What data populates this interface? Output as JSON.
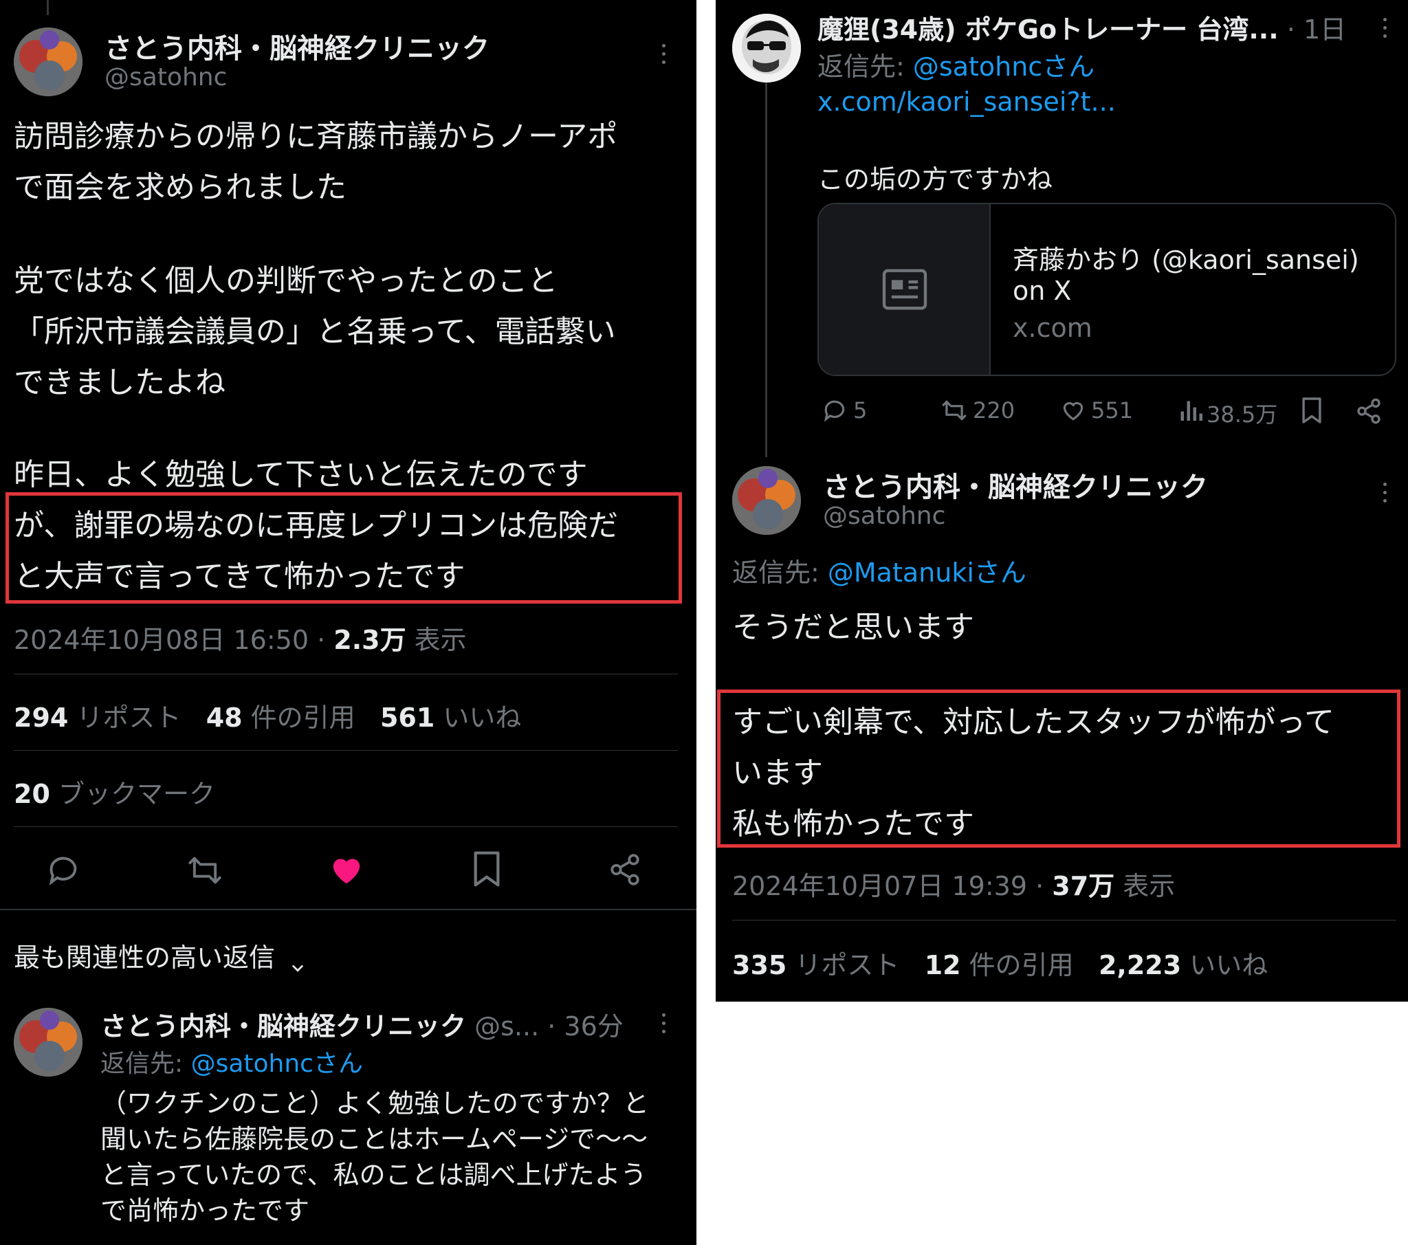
{
  "left": {
    "tweet": {
      "author_name": "さとう内科・脳神経クリニック",
      "author_handle": "@satohnc",
      "text_lines": [
        "訪問診療からの帰りに斉藤市議からノーアポ",
        "で面会を求められました",
        "党ではなく個人の判断でやったとのこと",
        "「所沢市議会議員の」と名乗って、電話繋い",
        "できましたよね",
        "昨日、よく勉強して下さいと伝えたのです",
        "が、謝罪の場なのに再度レプリコンは危険だ",
        "と大声で言ってきて怖かったです"
      ],
      "timestamp": "2024年10月08日 16:50 · ",
      "views_count": "2.3万",
      "views_label": " 表示",
      "stats": {
        "reposts_count": "294",
        "reposts_label": "リポスト",
        "quotes_count": "48",
        "quotes_label": "件の引用",
        "likes_count": "561",
        "likes_label": "いいね",
        "bookmarks_count": "20",
        "bookmarks_label": "ブックマーク"
      },
      "liked": true,
      "icons": [
        "reply-icon",
        "repost-icon",
        "heart-icon",
        "bookmark-icon",
        "share-icon"
      ]
    },
    "reply_sort_label": "最も関連性の高い返信",
    "reply": {
      "author_name": "さとう内科・脳神経クリニック",
      "author_handle_short": "@s...",
      "time": "· 36分",
      "reply_to_label": "返信先: ",
      "reply_to_handle": "@satohncさん",
      "text_lines": [
        "（ワクチンのこと）よく勉強したのですか？と",
        "聞いたら佐藤院長のことはホームページで〜〜",
        "と言っていたので、私のことは調べ上げたよう",
        "で尚怖かったです"
      ]
    }
  },
  "right": {
    "parent": {
      "author_name": "魔狸(34歳) ポケGoトレーナー 台湾...",
      "time": "· 1日",
      "reply_to_label": "返信先: ",
      "reply_to_handle": "@satohncさん",
      "url": "x.com/kaori_sansei?t...",
      "text": "この垢の方ですかね",
      "card": {
        "title_line1": "斉藤かおり (@kaori_sansei)",
        "title_line2": "on X",
        "domain": "x.com"
      },
      "actions": {
        "replies": "5",
        "reposts": "220",
        "likes": "551",
        "views": "38.5万"
      }
    },
    "main": {
      "author_name": "さとう内科・脳神経クリニック",
      "author_handle": "@satohnc",
      "reply_to_label": "返信先: ",
      "reply_to_handle": "@Matanukiさん",
      "text_line1": "そうだと思います",
      "highlight_lines": [
        "すごい剣幕で、対応したスタッフが怖がって",
        "います",
        "私も怖かったです"
      ],
      "timestamp": "2024年10月07日 19:39 · ",
      "views_count": "37万",
      "views_label": " 表示",
      "stats": {
        "reposts_count": "335",
        "reposts_label": "リポスト",
        "quotes_count": "12",
        "quotes_label": "件の引用",
        "likes_count": "2,223",
        "likes_label": "いいね"
      }
    }
  },
  "colors": {
    "background": "#000000",
    "text": "#e7e9ea",
    "muted": "#71767b",
    "link": "#1d9bf0",
    "like": "#f91880",
    "highlight_border": "#e0363a",
    "divider": "#2f3336"
  }
}
